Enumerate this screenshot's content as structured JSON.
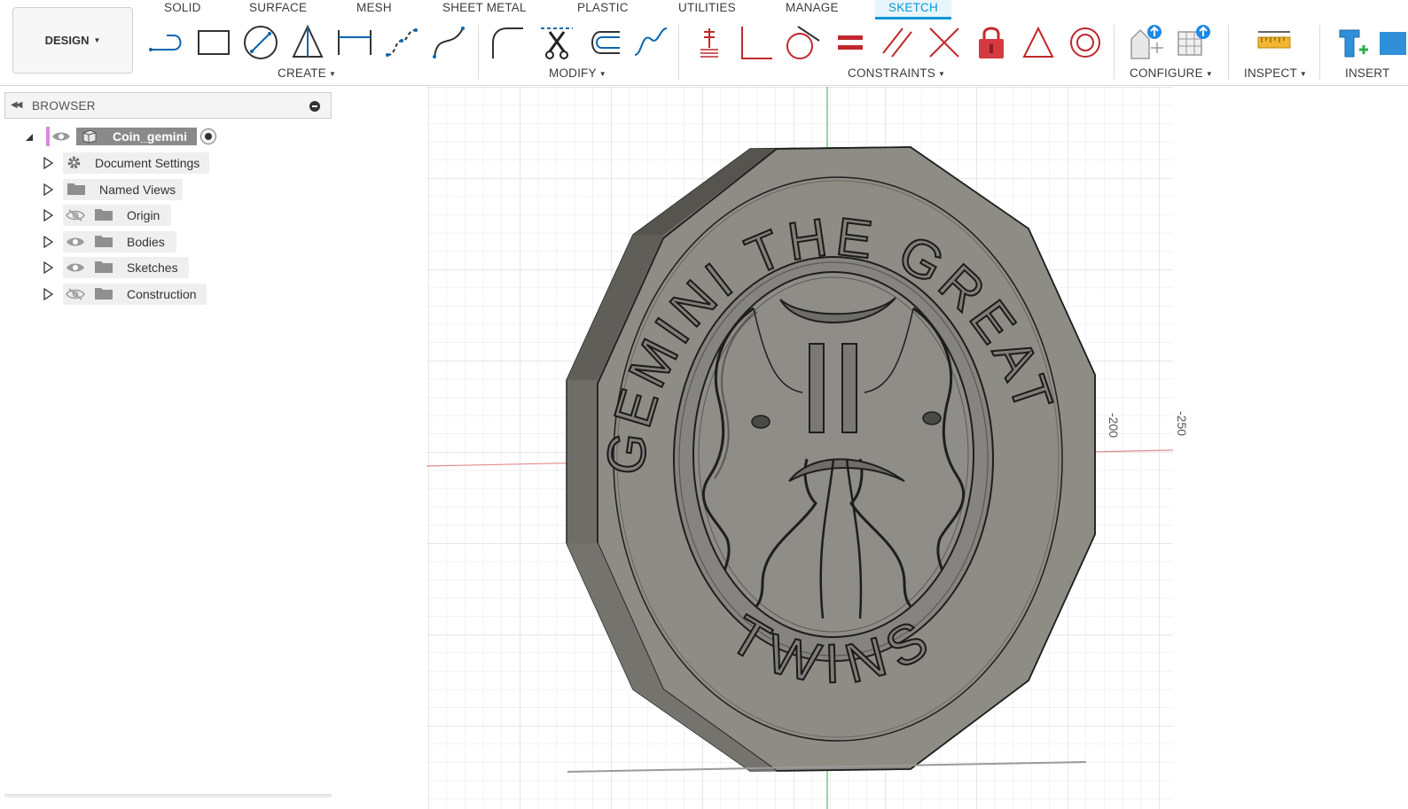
{
  "app": {
    "workspace_button": "DESIGN",
    "tabs": [
      {
        "label": "SOLID"
      },
      {
        "label": "SURFACE"
      },
      {
        "label": "MESH"
      },
      {
        "label": "SHEET METAL"
      },
      {
        "label": "PLASTIC"
      },
      {
        "label": "UTILITIES"
      },
      {
        "label": "MANAGE"
      },
      {
        "label": "SKETCH",
        "active": true
      }
    ],
    "groups": {
      "create": "CREATE",
      "modify": "MODIFY",
      "constraints": "CONSTRAINTS",
      "configure": "CONFIGURE",
      "inspect": "INSPECT",
      "insert": "INSERT"
    },
    "tools": {
      "create": [
        "line-icon",
        "rectangle-icon",
        "circle-icon",
        "polygon-icon",
        "dimension-icon",
        "spline-icon",
        "conic-curve-icon"
      ],
      "modify": [
        "fillet-icon",
        "trim-icon",
        "offset-icon",
        "curve-icon"
      ],
      "constraints": [
        "coincident-icon",
        "perpendicular-icon",
        "tangent-icon",
        "equal-icon",
        "parallel-icon",
        "collinear-icon",
        "fix-lock-icon",
        "triangle-icon",
        "concentric-icon"
      ],
      "configure": [
        "parameters-icon",
        "configuration-table-icon"
      ],
      "inspect": [
        "measure-icon"
      ],
      "insert": [
        "insert-derive-icon",
        "insert-mesh-icon"
      ]
    }
  },
  "browser": {
    "title": "BROWSER",
    "root": {
      "label": "Coin_gemini"
    },
    "items": [
      {
        "label": "Document Settings",
        "icon": "gear-icon",
        "visibility": "none"
      },
      {
        "label": "Named Views",
        "icon": "folder-icon",
        "visibility": "none"
      },
      {
        "label": "Origin",
        "icon": "folder-icon",
        "visibility": "hidden"
      },
      {
        "label": "Bodies",
        "icon": "folder-icon",
        "visibility": "visible"
      },
      {
        "label": "Sketches",
        "icon": "folder-icon",
        "visibility": "visible"
      },
      {
        "label": "Construction",
        "icon": "folder-icon",
        "visibility": "hidden"
      }
    ]
  },
  "canvas": {
    "dimensions": [
      "-200",
      "-250"
    ],
    "model": {
      "name": "Coin_gemini",
      "top_text": "GEMINI THE GREAT",
      "bottom_text": "TWINS",
      "symbol": "gemini-twins-emblem-icon",
      "color": "#8d8c85"
    }
  }
}
